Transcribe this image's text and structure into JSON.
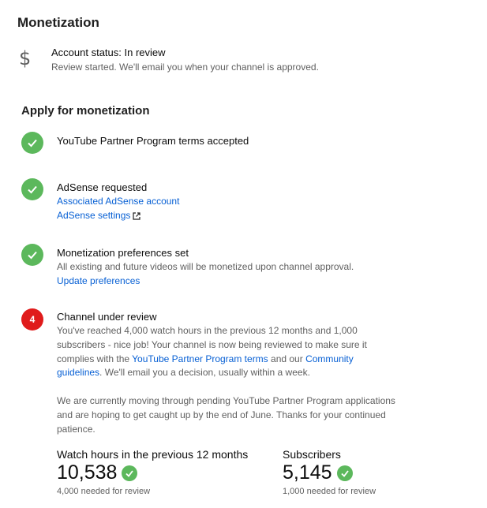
{
  "page": {
    "title": "Monetization"
  },
  "account_status": {
    "icon": "dollar-icon",
    "title": "Account status: In review",
    "subtitle": "Review started. We'll email you when your channel is approved."
  },
  "apply": {
    "title": "Apply for monetization",
    "steps": [
      {
        "icon": "check-icon",
        "title": "YouTube Partner Program terms accepted"
      },
      {
        "icon": "check-icon",
        "title": "AdSense requested",
        "link1": "Associated AdSense account",
        "link2": "AdSense settings"
      },
      {
        "icon": "check-icon",
        "title": "Monetization preferences set",
        "text": "All existing and future videos will be monetized upon channel approval.",
        "link1": "Update preferences"
      },
      {
        "number": "4",
        "title": "Channel under review",
        "text_a": "You've reached 4,000 watch hours in the previous 12 months and 1,000 subscribers - nice job! Your channel is now being reviewed to make sure it complies with the ",
        "link_terms": "YouTube Partner Program terms",
        "text_b": " and our ",
        "link_guidelines": "Community guidelines",
        "text_c": ". We'll email you a decision, usually within a week.",
        "note": "We are currently moving through pending YouTube Partner Program applications and are hoping to get caught up by the end of June. Thanks for your continued patience."
      }
    ]
  },
  "stats": {
    "watch_hours": {
      "label": "Watch hours in the previous 12 months",
      "value": "10,538",
      "needed": "4,000 needed for review"
    },
    "subscribers": {
      "label": "Subscribers",
      "value": "5,145",
      "needed": "1,000 needed for review"
    }
  },
  "colors": {
    "accent_green": "#5cb85c",
    "accent_red": "#e01b1b",
    "link_blue": "#065fd4"
  }
}
